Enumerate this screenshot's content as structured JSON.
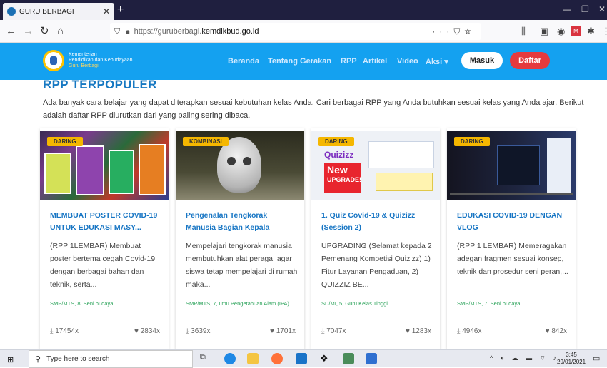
{
  "browser": {
    "tab_title": "GURU BERBAGI",
    "url_prefix": "https://guruberbagi.",
    "url_domain": "kemdikbud.go.id",
    "url_more": "···"
  },
  "site": {
    "brand_line1": "Kementerian",
    "brand_line2": "Pendidikan dan Kebudayaan",
    "brand_line3": "Guru Berbagi",
    "menu": [
      "Beranda",
      "Tentang Gerakan",
      "RPP",
      "Artikel",
      "Video",
      "Aksi ▾"
    ],
    "login_label": "Masuk",
    "register_label": "Daftar",
    "accent_color": "#14a1f0"
  },
  "section": {
    "title": "RPP TERPOPULER",
    "intro": "Ada banyak cara belajar yang dapat diterapkan sesuai kebutuhan kelas Anda. Cari berbagai RPP yang Anda butuhkan sesuai kelas yang Anda ajar. Berikut adalah daftar RPP diurutkan dari yang paling sering dibaca."
  },
  "cards": [
    {
      "badge": "DARING",
      "title": "MEMBUAT POSTER COVID-19 UNTUK EDUKASI MASY...",
      "desc": "(RPP 1LEMBAR) Membuat poster bertema cegah Covid-19 dengan berbagai bahan dan teknik, serta...",
      "meta": "SMP/MTS, 8, Seni budaya",
      "views": "17454x",
      "likes": "2834x"
    },
    {
      "badge": "KOMBINASI",
      "title": "Pengenalan Tengkorak Manusia Bagian Kepala",
      "desc": "Mempelajari tengkorak manusia membutuhkan alat peraga, agar siswa tetap mempelajari di rumah maka...",
      "meta": "SMP/MTS, 7, Ilmu Pengetahuan Alam (IPA)",
      "views": "3639x",
      "likes": "1701x"
    },
    {
      "badge": "DARING",
      "title": "1. Quiz Covid-19 & Quizizz (Session 2)",
      "desc": "UPGRADING (Selamat kepada 2 Pemenang Kompetisi Quizizz) 1) Fitur Layanan Pengaduan, 2) QUIZZIZ BE...",
      "meta": "SD/MI, 5, Guru Kelas Tinggi",
      "views": "7047x",
      "likes": "1283x",
      "thumb_text": {
        "brand": "Quizizz",
        "line1": "New",
        "line2": "UPGRADE!"
      }
    },
    {
      "badge": "DARING",
      "title": "EDUKASI COVID-19 DENGAN VLOG",
      "desc": "(RPP 1 LEMBAR) Memeragakan adegan fragmen sesuai konsep, teknik dan prosedur seni peran,...",
      "meta": "SMP/MTS, 7, Seni budaya",
      "views": "4946x",
      "likes": "842x"
    }
  ],
  "taskbar": {
    "search_placeholder": "Type here to search",
    "time": "3:45",
    "date": "29/01/2021"
  }
}
